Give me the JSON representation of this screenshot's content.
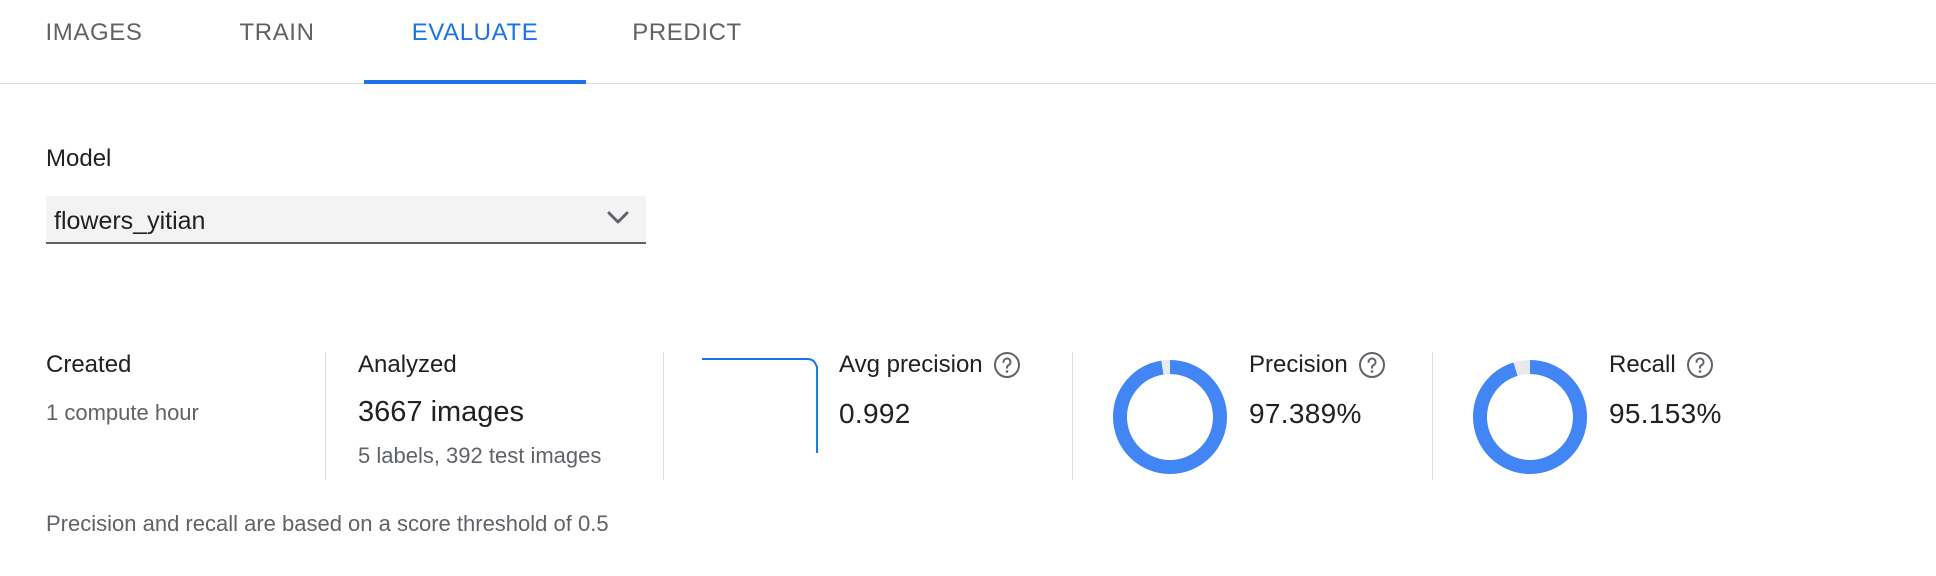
{
  "tabs": [
    {
      "label": "IMAGES",
      "active": false
    },
    {
      "label": "TRAIN",
      "active": false
    },
    {
      "label": "EVALUATE",
      "active": true
    },
    {
      "label": "PREDICT",
      "active": false
    }
  ],
  "model": {
    "label": "Model",
    "selected": "flowers_yitian"
  },
  "stats": {
    "created": {
      "title": "Created",
      "value": "1 compute hour"
    },
    "analyzed": {
      "title": "Analyzed",
      "value": "3667 images",
      "caption": "5 labels, 392 test images"
    },
    "avg_precision": {
      "title": "Avg precision",
      "value": "0.992",
      "score": 0.992
    },
    "precision": {
      "title": "Precision",
      "value": "97.389%",
      "percent": 97.389
    },
    "recall": {
      "title": "Recall",
      "value": "95.153%",
      "percent": 95.153
    }
  },
  "footnote": "Precision and recall are based on a score threshold of 0.5",
  "colors": {
    "accent": "#1a73e8",
    "donut_fill": "#4285f4",
    "donut_track": "#e8eaed",
    "curve": "#1a73e8"
  },
  "icons": {
    "help": "help-circle-icon",
    "chevron": "chevron-down-icon"
  }
}
